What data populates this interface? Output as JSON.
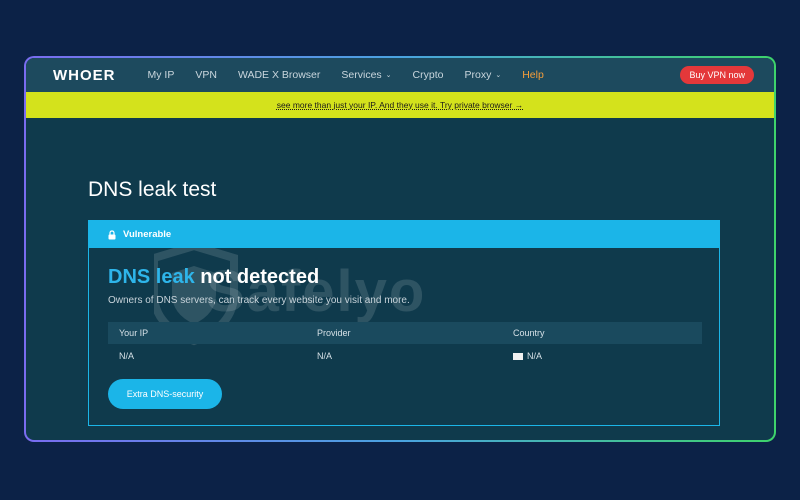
{
  "nav": {
    "logo": "WHOER",
    "items": [
      {
        "label": "My IP"
      },
      {
        "label": "VPN"
      },
      {
        "label": "WADE X Browser"
      },
      {
        "label": "Services",
        "dropdown": true
      },
      {
        "label": "Crypto"
      },
      {
        "label": "Proxy",
        "dropdown": true
      },
      {
        "label": "Help"
      }
    ],
    "cta_label": "Buy VPN now"
  },
  "banner": {
    "text": "see more than just your IP. And they use it. Try private browser →"
  },
  "page": {
    "title": "DNS leak test"
  },
  "card": {
    "status_label": "Vulnerable",
    "result_highlight": "DNS leak",
    "result_rest": " not detected",
    "description": "Owners of DNS servers, can track every website you visit and more.",
    "table": {
      "headers": [
        "Your IP",
        "Provider",
        "Country"
      ],
      "row": [
        "N/A",
        "N/A",
        "N/A"
      ]
    },
    "button_label": "Extra DNS-security"
  },
  "watermark": "Safelyo",
  "colors": {
    "background": "#0c2247",
    "accent": "#1bb5e8",
    "banner": "#d4e21c",
    "cta": "#e4383a",
    "help": "#f59e3a"
  }
}
